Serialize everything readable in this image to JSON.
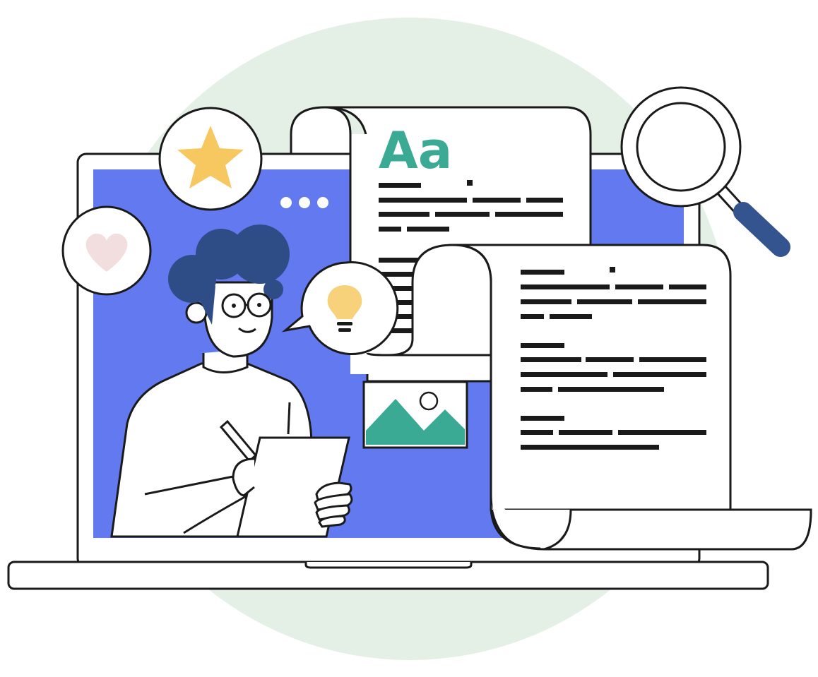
{
  "illustration": {
    "heading_text": "Aa",
    "window_dots": [
      "dot",
      "dot",
      "dot"
    ],
    "icons": [
      "star-icon",
      "heart-icon",
      "lightbulb-icon",
      "magnifier-icon",
      "image-icon",
      "pencil-icon"
    ]
  },
  "colors": {
    "background_circle": "#e4efe6",
    "screen_blue": "#6279f0",
    "accent_green": "#3aaa94",
    "star_yellow": "#f6c85f",
    "bulb_yellow": "#f8d27a",
    "heart_pink": "#f2dede",
    "hair_navy": "#2e4d86",
    "magnifier_handle": "#33548e",
    "outline": "#1a1a1a",
    "paper": "#ffffff"
  }
}
